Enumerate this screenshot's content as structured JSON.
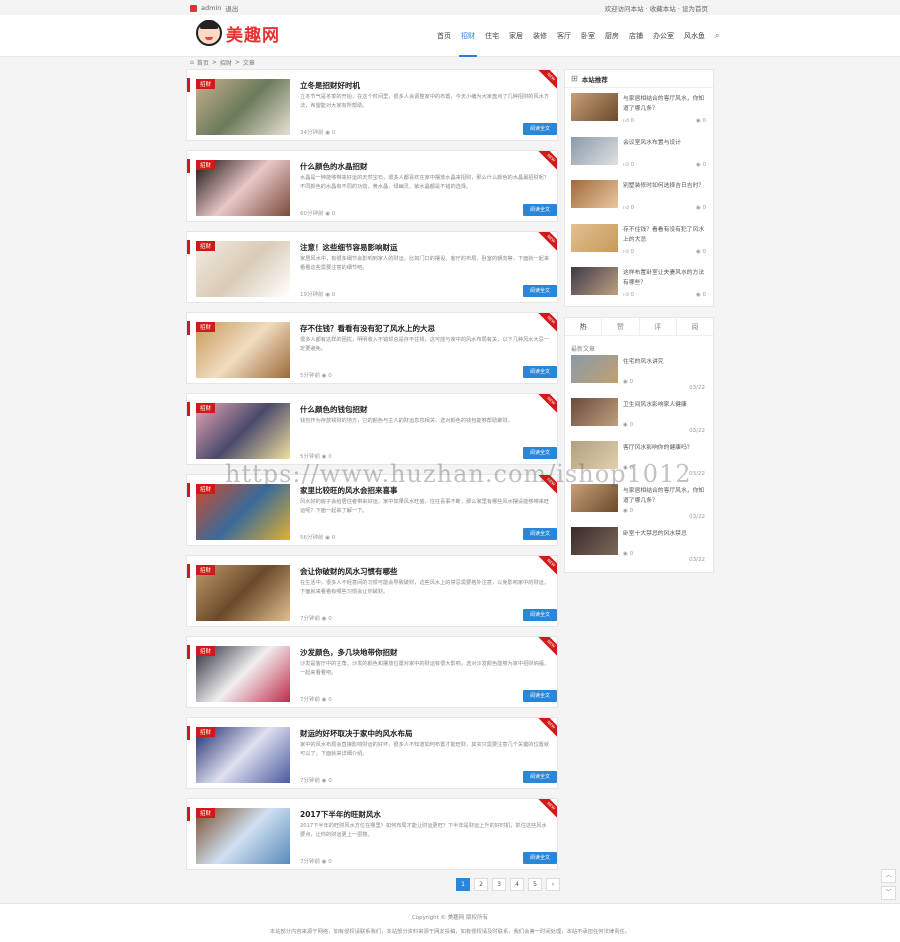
{
  "topbar": {
    "user": "admin",
    "user_extra": "退出",
    "right": "欢迎访问本站 · 收藏本站 · 设为首页"
  },
  "logo": {
    "text": "美趣网"
  },
  "nav": {
    "items": [
      "首页",
      "招财",
      "住宅",
      "家居",
      "装修",
      "客厅",
      "卧室",
      "厨房",
      "店铺",
      "办公室",
      "风水鱼"
    ],
    "active_index": 1
  },
  "breadcrumb": {
    "home": "首页",
    "sep": ">",
    "cat": "招财",
    "current": "文章"
  },
  "common": {
    "tag": "招财",
    "new": "NEW",
    "read": "阅读全文",
    "views": "0"
  },
  "articles": [
    {
      "title": "立冬是招财好时机",
      "excerpt": "立冬节气是冬季的开始，在这个时间里，很多人会调整家中的布置，今天小编为大家盘点了几种招财的风水方法，希望能对大家有所帮助。",
      "time": "34分钟前",
      "colors": [
        "#c9b08e",
        "#6a7a5a",
        "#e9e1d4"
      ]
    },
    {
      "title": "什么颜色的水晶招财",
      "excerpt": "水晶是一种能够带来好运的天然宝石，很多人都喜欢在家中摆放水晶来招财，那么什么颜色的水晶最招财呢？不同颜色的水晶有不同的功效，黄水晶、绿幽灵、紫水晶都是不错的选择。",
      "time": "60分钟前",
      "colors": [
        "#1a1010",
        "#e8c8c8",
        "#7a4a3a"
      ]
    },
    {
      "title": "注意！这些细节容易影响财运",
      "excerpt": "家居风水中，有很多细节会影响到家人的财运，比如门口的摆设、客厅的布局、卧室的朝向等，下面就一起来看看这些需要注意的细节吧。",
      "time": "19分钟前",
      "colors": [
        "#f2ede4",
        "#d9cbb5",
        "#ffffff"
      ]
    },
    {
      "title": "存不住钱？看看有没有犯了风水上的大忌",
      "excerpt": "很多人都有这样的困扰，明明收入不错却总是存不住钱，这可能与家中的风水布局有关，以下几种风水大忌一定要避免。",
      "time": "5分钟前",
      "colors": [
        "#c89a5a",
        "#f0dcc0",
        "#9a6a3a"
      ]
    },
    {
      "title": "什么颜色的钱包招财",
      "excerpt": "钱包作为存放钱财的地方，它的颜色与主人的财运息息相关，选对颜色的钱包能够帮助聚财。",
      "time": "5分钟前",
      "colors": [
        "#e6a5b8",
        "#4a4a6a",
        "#f0e0a0"
      ]
    },
    {
      "title": "家里比较旺的风水会招来喜事",
      "excerpt": "风水好的房子会给居住者带来好运，家中如果风水旺盛，往往喜事不断，那么家里有哪些风水摆设能够带来旺运呢？下面一起来了解一下。",
      "time": "56分钟前",
      "colors": [
        "#d04a2a",
        "#3a6a9a",
        "#e0b030"
      ]
    },
    {
      "title": "会让你破财的风水习惯有哪些",
      "excerpt": "在生活中，很多人不经意间的习惯可能会导致破财，这些风水上的禁忌需要格外注意，以免影响家中的财运，下面就来看看有哪些习惯会让你破财。",
      "time": "7分钟前",
      "colors": [
        "#c09a6a",
        "#6a4a2a",
        "#e0c090"
      ]
    },
    {
      "title": "沙发颜色，多几块地带你招财",
      "excerpt": "沙发是客厅中的主角，沙发的颜色和摆放位置对家中的财运有很大影响，选对沙发颜色能够为家中招财纳福，一起来看看吧。",
      "time": "7分钟前",
      "colors": [
        "#2a2a3a",
        "#f0f0f0",
        "#c02a4a"
      ]
    },
    {
      "title": "财运的好坏取决于家中的风水布局",
      "excerpt": "家中的风水布局会直接影响财运的好坏，很多人不知道如何布置才能旺财，其实只需要注意几个关键的位置就可以了，下面就来详细介绍。",
      "time": "7分钟前",
      "colors": [
        "#1a2a6a",
        "#e0e0f0",
        "#4a5aa0"
      ]
    },
    {
      "title": "2017下半年的旺财风水",
      "excerpt": "2017下半年的旺财风水方位在哪里？如何布局才能让财运更旺？下半年是财运上升的好时机，抓住这些风水要点，让你的财运更上一层楼。",
      "time": "7分钟前",
      "colors": [
        "#7a4a2a",
        "#d0e0f0",
        "#5a8aba"
      ]
    }
  ],
  "pagination": {
    "pages": [
      "1",
      "2",
      "3",
      "4",
      "5"
    ],
    "next": "›",
    "active": "1"
  },
  "sidebar": {
    "recommend_title": "本站推荐",
    "recommend": [
      {
        "title": "与家居相结合的客厅风水，你知道了哪几条？",
        "likes": "0",
        "views": "0"
      },
      {
        "title": "会议室风水布置与设计",
        "likes": "0",
        "views": "0"
      },
      {
        "title": "别墅装修时如何选择吉日吉时？",
        "likes": "0",
        "views": "0"
      },
      {
        "title": "存不住钱？看看有没有犯了风水上的大忌",
        "likes": "0",
        "views": "0"
      },
      {
        "title": "这样布置卧室让夫妻风水的方法有哪些？",
        "likes": "0",
        "views": "0"
      }
    ],
    "tabs": [
      "热",
      "赞",
      "评",
      "阅"
    ],
    "hot_title": "最新文章",
    "hot": [
      {
        "title": "住宅的风水讲究",
        "views": "0",
        "date": "03/22"
      },
      {
        "title": "卫生间风水影响家人健康",
        "views": "0",
        "date": "03/22"
      },
      {
        "title": "客厅风水影响你的健康吗？",
        "views": "0",
        "date": "03/22"
      },
      {
        "title": "与家居相结合的客厅风水，你知道了哪几条？",
        "views": "0",
        "date": "03/22"
      },
      {
        "title": "卧室十大禁忌的风水禁忌",
        "views": "0",
        "date": "03/22"
      }
    ]
  },
  "footer": {
    "copyright": "Copyright © 美趣网 版权所有",
    "disclaimer": "本站部分内容来源于网络，如有侵权请联系我们，本站部分资料来源于网友投稿，如有侵权请及时联系，我们会第一时间处理，本站不承担任何法律责任。"
  },
  "float": {
    "up": "︿",
    "down": "﹀",
    "qr": "▦"
  },
  "watermark": "https://www.huzhan.com/ishop1012",
  "colors": {
    "accent": "#2a86d6",
    "tag": "#d21919",
    "logo": "#e53333"
  }
}
